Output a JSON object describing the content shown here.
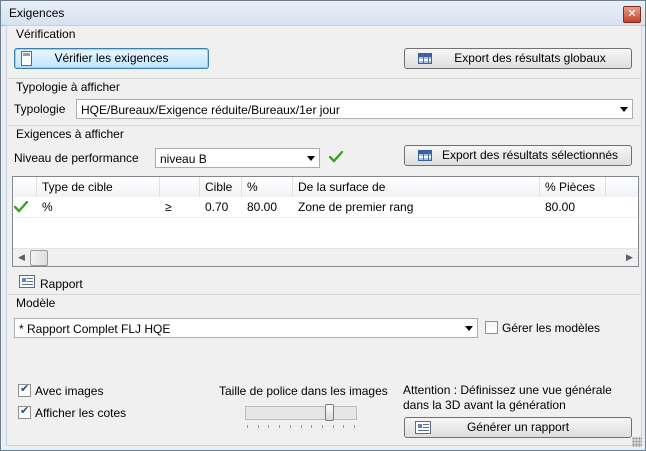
{
  "window": {
    "title": "Exigences"
  },
  "sections": {
    "verification": "Vérification",
    "typologie": "Typologie à afficher",
    "exigences": "Exigences à afficher",
    "modele": "Modèle"
  },
  "buttons": {
    "verifier": "Vérifier les exigences",
    "export_global": "Export des résultats globaux",
    "export_selection": "Export des résultats sélectionnés",
    "generer": "Générer un rapport"
  },
  "typologie": {
    "label": "Typologie",
    "value": "HQE/Bureaux/Exigence réduite/Bureaux/1er jour"
  },
  "niveau": {
    "label": "Niveau de performance",
    "value": "niveau B"
  },
  "grid": {
    "headers": [
      "Type de cible",
      "",
      "Cible",
      "%",
      "De la surface de",
      "% Pièces"
    ],
    "rows": [
      [
        "%",
        "≥",
        "0.70",
        "80.00",
        "Zone de premier rang",
        "80.00"
      ]
    ]
  },
  "rapport": {
    "label": "Rapport"
  },
  "modele": {
    "value": "* Rapport Complet FLJ HQE",
    "gerer_label": "Gérer les modèles",
    "gerer_checked": false
  },
  "options": {
    "avec_images": {
      "label": "Avec images",
      "checked": true
    },
    "afficher_cotes": {
      "label": "Afficher les cotes",
      "checked": true
    }
  },
  "font_size": {
    "label": "Taille de police dans les images",
    "level": 0.78
  },
  "attention": "Attention : Définissez une vue générale dans la 3D avant la génération",
  "colors": {
    "ok_green": "#3aa21c",
    "accent_blue": "#3c7fb1"
  }
}
